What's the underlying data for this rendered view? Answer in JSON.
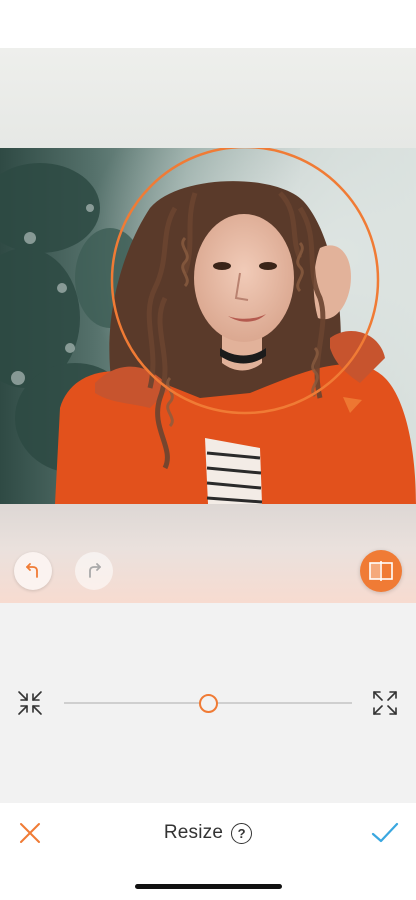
{
  "editor": {
    "tool_title": "Resize",
    "help_symbol": "?",
    "history": {
      "undo_icon": "undo-arrow-icon",
      "redo_icon": "redo-arrow-icon"
    },
    "compare_icon": "compare-split-icon"
  },
  "resize_slider": {
    "value": 0.5,
    "min_icon": "shrink-arrows-icon",
    "max_icon": "expand-arrows-icon"
  },
  "actions": {
    "cancel_icon": "close-x-icon",
    "confirm_icon": "checkmark-icon"
  },
  "colors": {
    "accent": "#f07b35",
    "confirm": "#3aa7e0",
    "panel_background": "#f2f2f2",
    "text": "#333333"
  }
}
